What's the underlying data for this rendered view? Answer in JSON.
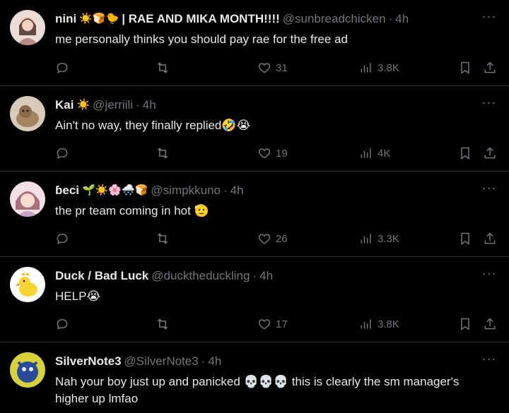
{
  "tweets": [
    {
      "name": "nini",
      "name_emojis": "☀️🍞🐤",
      "name_suffix": "| RAE AND MIKA MONTH!!!!",
      "handle": "@sunbreadchicken",
      "time": "4h",
      "text": "me personally thinks you should pay rae for the free ad",
      "likes": "31",
      "views": "3.8K"
    },
    {
      "name": "Kai",
      "name_emojis": "☀️",
      "name_suffix": "",
      "handle": "@jerriili",
      "time": "4h",
      "text": "Ain't no way, they finally replied🤣😭",
      "likes": "19",
      "views": "4K"
    },
    {
      "name": "ɓeci",
      "name_emojis": "🌱☀️🌸🌨️🍞",
      "name_suffix": "",
      "handle": "@simpkkuno",
      "time": "4h",
      "text": "the pr team coming in hot 🫡",
      "likes": "26",
      "views": "3.3K"
    },
    {
      "name": "Duck / Bad Luck",
      "name_emojis": "",
      "name_suffix": "",
      "handle": "@ducktheduckling",
      "time": "4h",
      "text": "HELP😭",
      "likes": "17",
      "views": "3.8K"
    },
    {
      "name": "SilverNote3",
      "name_emojis": "",
      "name_suffix": "",
      "handle": "@SilverNote3",
      "time": "4h",
      "text": "Nah your boy just up and panicked 💀💀💀 this is clearly the sm manager's higher up lmfao",
      "likes": "",
      "views": ""
    }
  ],
  "dot": "·",
  "more_glyph": "···",
  "colors": {
    "background": "#000000",
    "text": "#e7e9ea",
    "muted": "#71767b",
    "divider": "#2f3336"
  },
  "icons": [
    "reply-icon",
    "retweet-icon",
    "like-icon",
    "views-icon",
    "bookmark-icon",
    "share-icon",
    "more-icon"
  ]
}
